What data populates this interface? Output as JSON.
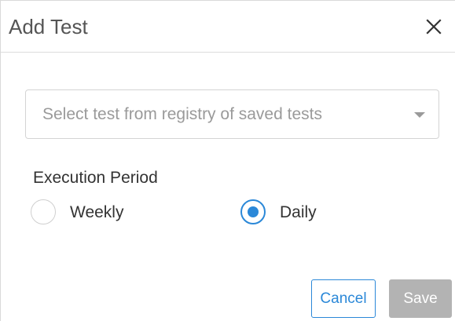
{
  "dialog": {
    "title": "Add Test",
    "close_icon": "close-icon"
  },
  "test_select": {
    "placeholder": "Select test from registry of saved tests",
    "caret_icon": "chevron-down-icon"
  },
  "execution_period": {
    "label": "Execution Period",
    "options": [
      {
        "label": "Weekly",
        "checked": false
      },
      {
        "label": "Daily",
        "checked": true
      }
    ]
  },
  "footer": {
    "cancel_label": "Cancel",
    "save_label": "Save",
    "save_disabled": true
  },
  "colors": {
    "accent": "#2b88d8",
    "disabled_button": "#b3b3b3",
    "border": "#d4d4d4",
    "placeholder_text": "#9a9a9a"
  }
}
